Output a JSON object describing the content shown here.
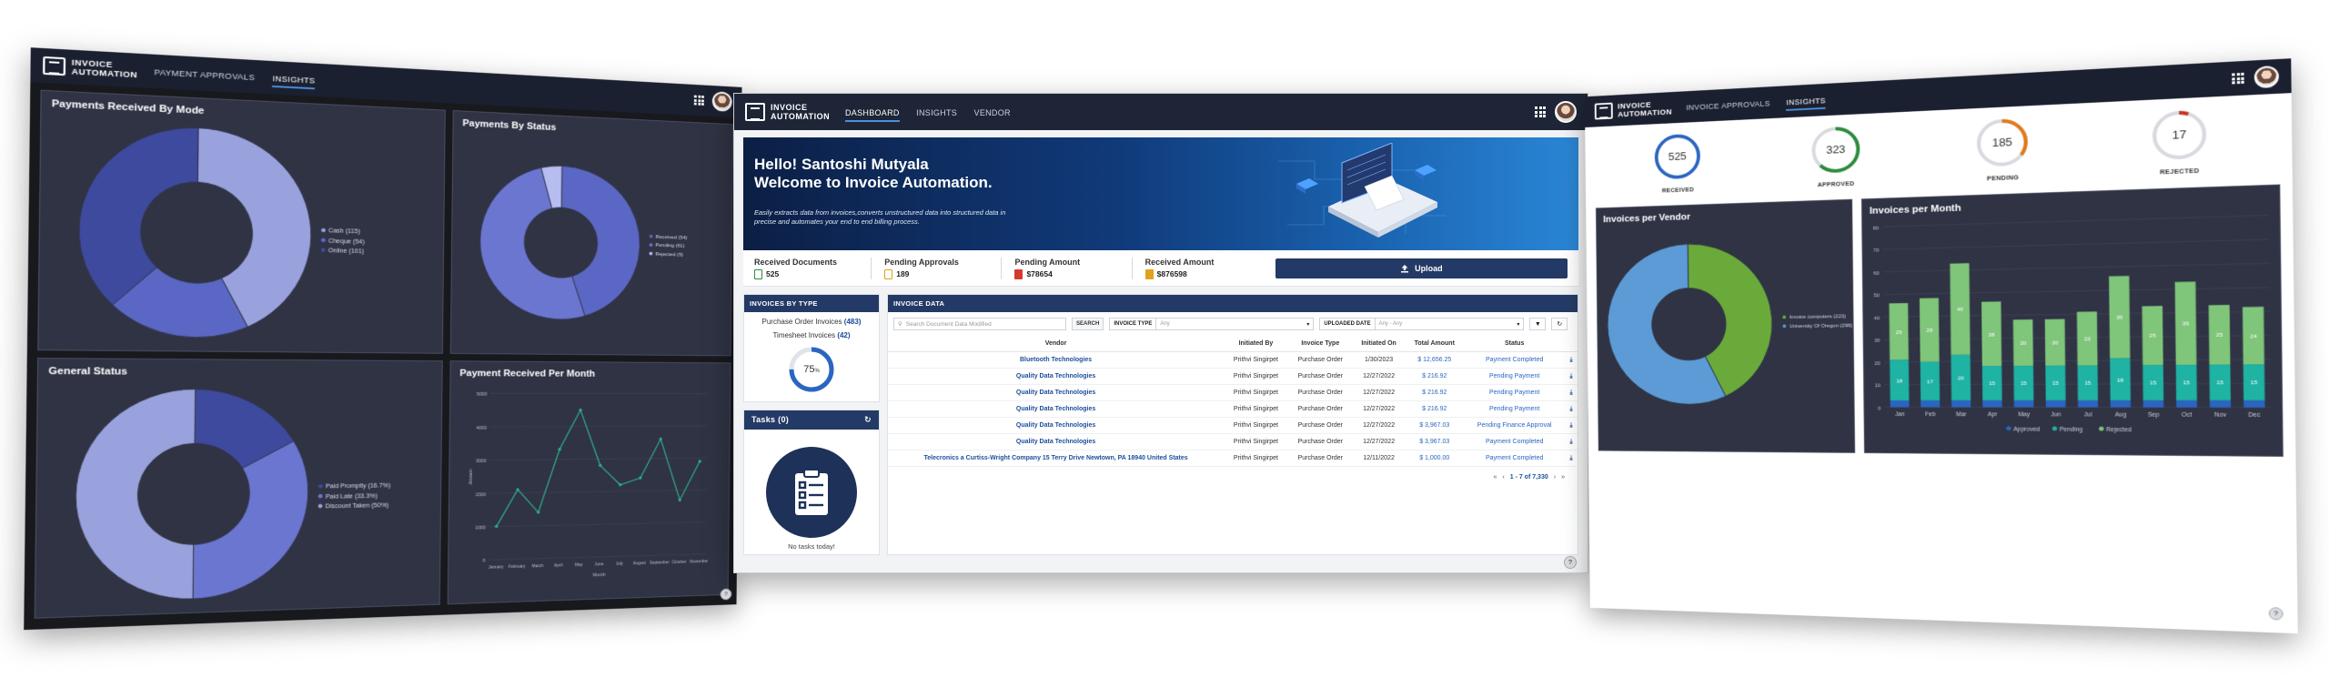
{
  "brand": {
    "logo_text": "INVOICE\nAUTOMATION"
  },
  "left_screen": {
    "nav": [
      "PAYMENT APPROVALS",
      "INSIGHTS"
    ],
    "active_nav": 1,
    "panels": {
      "by_mode_title": "Payments Received By Mode",
      "by_status_title": "Payments By Status",
      "general_title": "General  Status",
      "per_month_title": "Payment Received Per Month"
    }
  },
  "center_screen": {
    "nav": [
      "DASHBOARD",
      "INSIGHTS",
      "VENDOR"
    ],
    "active_nav": 0,
    "hero": {
      "greeting": "Hello! Santoshi Mutyala",
      "welcome": "Welcome to Invoice Automation.",
      "description": "Easily extracts data from invoices,converts unstructured data into structured data in precise and automates your end to end billing process."
    },
    "stats": [
      {
        "label": "Received Documents",
        "value": "525",
        "color": "#2e8b3e"
      },
      {
        "label": "Pending Approvals",
        "value": "189",
        "color": "#e0a21b"
      },
      {
        "label": "Pending Amount",
        "value": "$78654",
        "color": "#d53a2e"
      },
      {
        "label": "Received Amount",
        "value": "$876598",
        "color": "#e0a21b"
      }
    ],
    "upload_label": "Upload",
    "invoices_by_type": {
      "title": "INVOICES BY TYPE",
      "po_label": "Purchase Order Invoices",
      "po_count": "(483)",
      "ts_label": "Timesheet Invoices",
      "ts_count": "(42)",
      "percent": "75",
      "percent_unit": "%",
      "fraction": 0.75
    },
    "tasks": {
      "title": "Tasks (0)",
      "empty_text": "No tasks today!"
    },
    "invoice_data": {
      "title": "INVOICE DATA",
      "search_placeholder": "Search Document Data Modified",
      "search_button": "SEARCH",
      "invoice_type_label": "INVOICE TYPE",
      "invoice_type_value": "Any",
      "uploaded_date_label": "UPLOADED DATE",
      "uploaded_date_value": "Any - Any",
      "columns": [
        "Vendor",
        "Initiated By",
        "Invoice Type",
        "Initiated On",
        "Total Amount",
        "Status"
      ],
      "rows": [
        [
          "Bluetooth Technologies",
          "Prithvi Singirpet",
          "Purchase Order",
          "1/30/2023",
          "$ 12,656.25",
          "Payment Completed"
        ],
        [
          "Quality Data Technologies",
          "Prithvi Singirpet",
          "Purchase Order",
          "12/27/2022",
          "$ 216.92",
          "Pending Payment"
        ],
        [
          "Quality Data Technologies",
          "Prithvi Singirpet",
          "Purchase Order",
          "12/27/2022",
          "$ 216.92",
          "Pending Payment"
        ],
        [
          "Quality Data Technologies",
          "Prithvi Singirpet",
          "Purchase Order",
          "12/27/2022",
          "$ 216.92",
          "Pending Payment"
        ],
        [
          "Quality Data Technologies",
          "Prithvi Singirpet",
          "Purchase Order",
          "12/27/2022",
          "$ 3,967.03",
          "Pending Finance Approval"
        ],
        [
          "Quality Data Technologies",
          "Prithvi Singirpet",
          "Purchase Order",
          "12/27/2022",
          "$ 3,967.03",
          "Payment Completed"
        ],
        [
          "Telecronics a Curtiss-Wright Company 15 Terry Drive Newtown, PA 18940 United States",
          "Prithvi Singirpet",
          "Purchase Order",
          "12/11/2022",
          "$ 1,000.00",
          "Payment Completed"
        ]
      ],
      "pager_text": "1 - 7 of 7,330"
    }
  },
  "right_screen": {
    "nav": [
      "INVOICE APPROVALS",
      "INSIGHTS"
    ],
    "active_nav": 1,
    "counters": [
      {
        "value": "525",
        "label": "RECEIVED",
        "color": "#2a66c1",
        "fraction": 1.0
      },
      {
        "value": "323",
        "label": "APPROVED",
        "color": "#2e8b3e",
        "fraction": 0.62
      },
      {
        "value": "185",
        "label": "PENDING",
        "color": "#e07a1b",
        "fraction": 0.35
      },
      {
        "value": "17",
        "label": "REJECTED",
        "color": "#c93226",
        "fraction": 0.06
      }
    ],
    "vendor_title": "Invoices per Vendor",
    "month_title": "Invoices per Month"
  },
  "chart_data": [
    {
      "type": "pie",
      "title": "Payments Received By Mode",
      "categories": [
        "Cash",
        "Cheque",
        "Online"
      ],
      "legend_labels": [
        "Cash (115)",
        "Cheque (54)",
        "Online (101)"
      ],
      "values": [
        115,
        54,
        101
      ],
      "colors": [
        "#9aa2dd",
        "#5b67c4",
        "#3e4a9e"
      ]
    },
    {
      "type": "pie",
      "title": "Payments By Status",
      "categories": [
        "Received",
        "Pending",
        "Rejected"
      ],
      "legend_labels": [
        "Received (54)",
        "Pending (61)",
        "Rejected (5)"
      ],
      "values": [
        54,
        61,
        5
      ],
      "colors": [
        "#5b67c4",
        "#6a76d0",
        "#b7bdf0"
      ]
    },
    {
      "type": "pie",
      "title": "General  Status",
      "categories": [
        "Paid Promptly",
        "Paid Late",
        "Discount Taken"
      ],
      "legend_labels": [
        "Paid Promptly (16.7%)",
        "Paid Late (33.3%)",
        "Discount Taken (50%)"
      ],
      "values": [
        16.7,
        33.3,
        50
      ],
      "colors": [
        "#3e4a9e",
        "#6a76d0",
        "#9aa2dd"
      ]
    },
    {
      "type": "line",
      "title": "Payment Received Per Month",
      "x": [
        "January",
        "February",
        "March",
        "April",
        "May",
        "June",
        "July",
        "August",
        "September",
        "October",
        "November"
      ],
      "values": [
        1000,
        2100,
        1400,
        3300,
        4500,
        2800,
        2200,
        2400,
        3600,
        1700,
        2900
      ],
      "ylim": [
        0,
        5000
      ],
      "yticks": [
        0,
        1000,
        2000,
        3000,
        4000,
        5000
      ],
      "xlabel": "Month",
      "ylabel": "Amount",
      "color": "#2fb38a"
    },
    {
      "type": "pie",
      "title": "Invoices per Vendor",
      "categories": [
        "Invoice computers",
        "University Of Oregon"
      ],
      "legend_labels": [
        "Invoice computers (223)",
        "University Of Oregon (298)"
      ],
      "values": [
        223,
        298
      ],
      "colors": [
        "#6aaa3a",
        "#5c9bd5"
      ]
    },
    {
      "type": "bar",
      "title": "Invoices per Month",
      "categories": [
        "Jan",
        "Feb",
        "Mar",
        "Apr",
        "May",
        "Jun",
        "Jul",
        "Aug",
        "Sep",
        "Oct",
        "Nov",
        "Dec"
      ],
      "series": [
        {
          "name": "Approved",
          "values": [
            3,
            3,
            3,
            3,
            3,
            3,
            3,
            3,
            3,
            3,
            3,
            3
          ],
          "color": "#2a66c1"
        },
        {
          "name": "Pending",
          "values": [
            18,
            17,
            20,
            15,
            15,
            15,
            15,
            18,
            15,
            15,
            15,
            15
          ],
          "color": "#1fb3a3"
        },
        {
          "name": "Rejected",
          "values": [
            25,
            28,
            40,
            28,
            20,
            20,
            23,
            35,
            25,
            35,
            25,
            24
          ],
          "color": "#7fc57a"
        }
      ],
      "legend_labels": [
        "Approved",
        "Pending",
        "Rejected"
      ],
      "ylim": [
        0,
        80
      ],
      "yticks": [
        0,
        10,
        20,
        30,
        40,
        50,
        60,
        70,
        80
      ]
    }
  ]
}
